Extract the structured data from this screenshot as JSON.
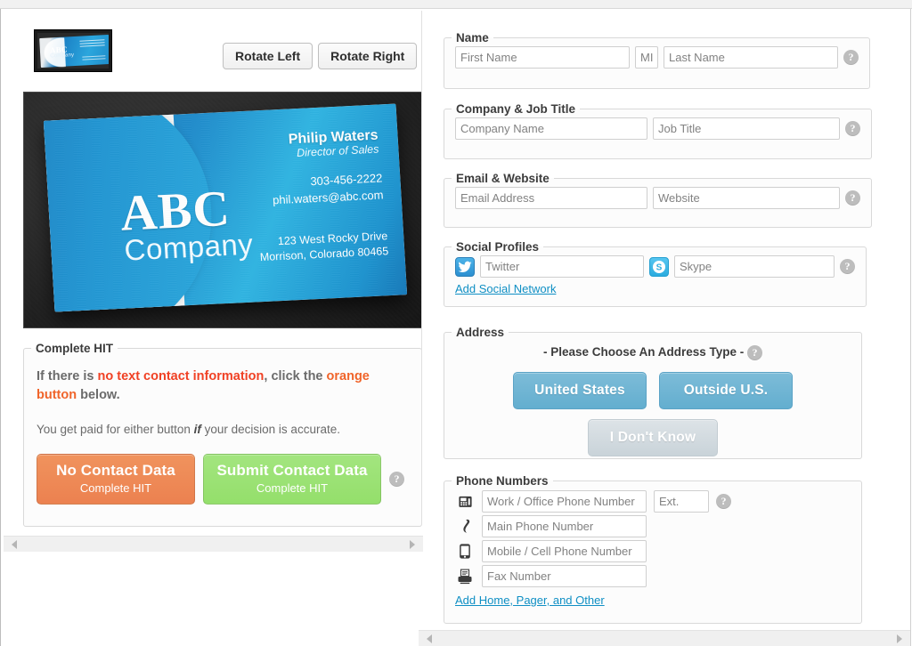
{
  "left": {
    "thumbnail_alt": "business-card-thumbnail",
    "rotate_left": "Rotate Left",
    "rotate_right": "Rotate Right",
    "card": {
      "logo_main": "ABC",
      "logo_sub": "Company",
      "person_name": "Philip Waters",
      "person_title": "Director of Sales",
      "phone": "303-456-2222",
      "email": "phil.waters@abc.com",
      "address_line1": "123 West Rocky Drive",
      "address_line2": "Morrison, Colorado 80465"
    },
    "hit": {
      "legend": "Complete HIT",
      "instruction_prefix": "If there is ",
      "instruction_red": "no text contact information",
      "instruction_mid": ", click the ",
      "instruction_orange": "orange button",
      "instruction_suffix": " below.",
      "paid_prefix": "You get paid for either button ",
      "paid_emph": "if",
      "paid_suffix": " your decision is accurate.",
      "no_contact_title": "No Contact Data",
      "no_contact_sub": "Complete HIT",
      "submit_title": "Submit Contact Data",
      "submit_sub": "Complete HIT",
      "help": "?"
    }
  },
  "right": {
    "name": {
      "legend": "Name",
      "first_placeholder": "First Name",
      "mi_placeholder": "MI",
      "last_placeholder": "Last Name",
      "help": "?"
    },
    "company": {
      "legend": "Company & Job Title",
      "company_placeholder": "Company Name",
      "job_placeholder": "Job Title",
      "help": "?"
    },
    "email": {
      "legend": "Email & Website",
      "email_placeholder": "Email Address",
      "website_placeholder": "Website",
      "help": "?"
    },
    "social": {
      "legend": "Social Profiles",
      "twitter_icon": "twitter-icon",
      "twitter_placeholder": "Twitter",
      "skype_icon": "skype-icon",
      "skype_placeholder": "Skype",
      "add_link": "Add Social Network",
      "help": "?"
    },
    "address": {
      "legend": "Address",
      "prompt": "- Please Choose An Address Type -",
      "btn_us": "United States",
      "btn_outside": "Outside U.S.",
      "btn_idk": "I Don't Know",
      "help": "?"
    },
    "phone": {
      "legend": "Phone Numbers",
      "work_placeholder": "Work / Office Phone Number",
      "ext_placeholder": "Ext.",
      "main_placeholder": "Main Phone Number",
      "mobile_placeholder": "Mobile / Cell Phone Number",
      "fax_placeholder": "Fax Number",
      "add_link": "Add Home, Pager, and Other",
      "help": "?"
    }
  },
  "colors": {
    "orange_button": "#ec8150",
    "green_button": "#94df6b",
    "blue_button": "#63aecf",
    "disabled_button": "#c9d3d9",
    "link": "#0f8fc4",
    "alert_red": "#f04124",
    "alert_orange": "#f0642a"
  }
}
